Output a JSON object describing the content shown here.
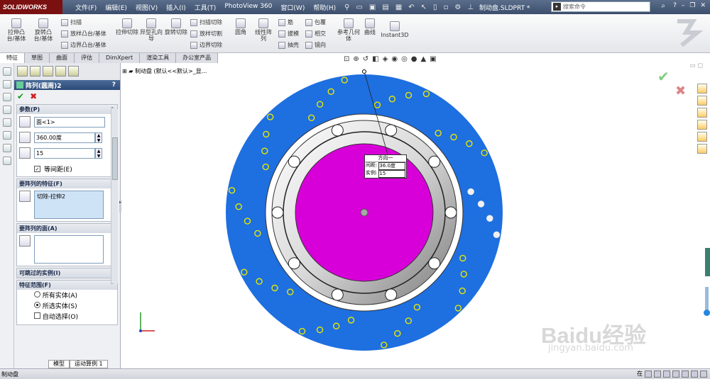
{
  "app": {
    "logo": "SOLIDWORKS",
    "doc_name": "制动盘.SLDPRT *"
  },
  "menu": [
    "文件(F)",
    "编辑(E)",
    "视图(V)",
    "插入(I)",
    "工具(T)",
    "PhotoView 360",
    "窗口(W)",
    "帮助(H)"
  ],
  "search": {
    "placeholder": "搜索命令"
  },
  "ribbon": {
    "big": [
      "拉伸凸台/基体",
      "旋转凸台/基体",
      "拉伸切除",
      "异型孔向导",
      "旋转切除",
      "圆角",
      "线性阵列",
      "参考几何体",
      "曲线",
      "Instant3D"
    ],
    "small": [
      "扫描",
      "放样凸台/基体",
      "边界凸台/基体",
      "扫描切除",
      "放样切割",
      "边界切除",
      "筋",
      "拔模",
      "抽壳",
      "包覆",
      "相交",
      "镜向"
    ]
  },
  "command_tabs": [
    "特征",
    "草图",
    "曲面",
    "评估",
    "DimXpert",
    "渲染工具",
    "办公室产品"
  ],
  "property_manager": {
    "title": "阵列(圆周)2",
    "help": "?",
    "params": {
      "label": "参数(P)",
      "axis": "面<1>",
      "angle": "360.00度",
      "count": "15",
      "equal_spacing": "等间距(E)"
    },
    "features": {
      "label": "要阵列的特征(F)",
      "item": "切除-拉伸2"
    },
    "faces": {
      "label": "要阵列的面(A)"
    },
    "skip": {
      "label": "可跳过的实例(I)"
    },
    "scope": {
      "label": "特征范围(F)",
      "all": "所有实体(A)",
      "selected": "所选实体(S)",
      "auto": "自动选择(O)"
    }
  },
  "tree": {
    "text": "制动盘 (默认<<默认>_显..."
  },
  "callout": {
    "title": "方向一",
    "spacing_label": "间距:",
    "spacing": "36.0度",
    "instances_label": "实例:",
    "instances": "15"
  },
  "bottom_tabs": [
    "模型",
    "运动算例 1"
  ],
  "status": {
    "left": "制动盘",
    "right": "在"
  },
  "watermark": {
    "main": "Baidu经验",
    "sub": "jingyan.baidu.com"
  },
  "colors": {
    "disc": "#1e6fe0",
    "hub": "#d800d8",
    "holes": "#e8e800",
    "title_bar": "#3c4e6c"
  }
}
